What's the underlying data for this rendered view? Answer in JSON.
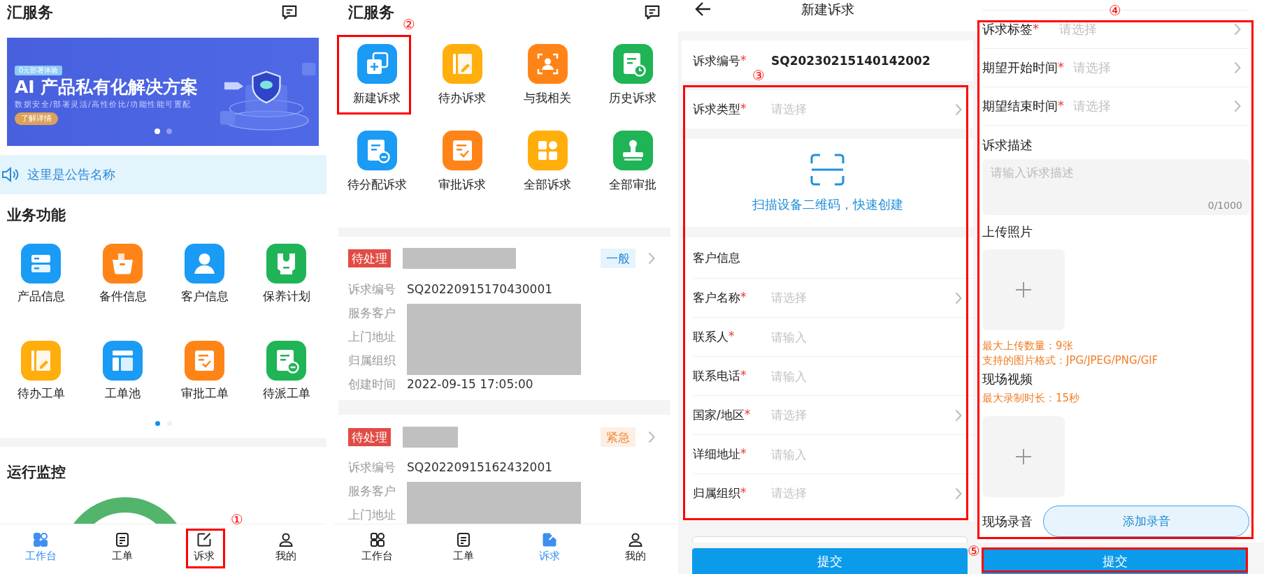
{
  "home": {
    "title": "汇服务",
    "banner": {
      "tag": "0元部署体验",
      "headline": "AI 产品私有化解决方案",
      "subtitle": "数据安全/部署灵活/高性价比/功能性能可置配",
      "button": "了解详情",
      "slides": [
        {
          "selected": true
        },
        {
          "selected": false
        }
      ]
    },
    "notice": "这里是公告名称",
    "functions": {
      "title": "业务功能",
      "items": [
        {
          "label": "产品信息",
          "color": "#1a9bf5"
        },
        {
          "label": "备件信息",
          "color": "#ff8417"
        },
        {
          "label": "客户信息",
          "color": "#1a9bf5"
        },
        {
          "label": "保养计划",
          "color": "#1fb455"
        },
        {
          "label": "待办工单",
          "color": "#ffae0c"
        },
        {
          "label": "工单池",
          "color": "#1a9bf5"
        },
        {
          "label": "审批工单",
          "color": "#ff8417"
        },
        {
          "label": "待派工单",
          "color": "#1fb455"
        }
      ],
      "pages": [
        {
          "selected": true
        },
        {
          "selected": false
        }
      ]
    },
    "monitor": {
      "title": "运行监控"
    },
    "nav": [
      {
        "label": "工作台",
        "selected": true
      },
      {
        "label": "工单",
        "selected": false
      },
      {
        "label": "诉求",
        "selected": false
      },
      {
        "label": "我的",
        "selected": false
      }
    ]
  },
  "requests": {
    "title": "汇服务",
    "items": [
      {
        "label": "新建诉求",
        "color": "#1a9bf5"
      },
      {
        "label": "待办诉求",
        "color": "#ffae0c"
      },
      {
        "label": "与我相关",
        "color": "#ff8417"
      },
      {
        "label": "历史诉求",
        "color": "#1fb455"
      },
      {
        "label": "待分配诉求",
        "color": "#1a9bf5"
      },
      {
        "label": "审批诉求",
        "color": "#ff8417"
      },
      {
        "label": "全部诉求",
        "color": "#ffae0c"
      },
      {
        "label": "全部审批",
        "color": "#1fb455"
      }
    ],
    "cards": [
      {
        "status": "待处理",
        "priority": {
          "text": "一般",
          "kind": "normal"
        },
        "fields": [
          {
            "label": "诉求编号",
            "value": "SQ20220915170430001"
          },
          {
            "label": "服务客户"
          },
          {
            "label": "上门地址"
          },
          {
            "label": "归属组织"
          },
          {
            "label": "创建时间",
            "value": "2022-09-15 17:05:00"
          }
        ]
      },
      {
        "status": "待处理",
        "priority": {
          "text": "紧急",
          "kind": "urgent"
        },
        "fields": [
          {
            "label": "诉求编号",
            "value": "SQ20220915162432001"
          },
          {
            "label": "服务客户"
          },
          {
            "label": "上门地址"
          }
        ]
      }
    ],
    "nav": [
      {
        "label": "工作台",
        "selected": false
      },
      {
        "label": "工单",
        "selected": false
      },
      {
        "label": "诉求",
        "selected": true
      },
      {
        "label": "我的",
        "selected": false
      }
    ]
  },
  "new_request": {
    "title": "新建诉求",
    "number": {
      "label": "诉求编号",
      "asterisk": "*",
      "value": "SQ20230215140142002"
    },
    "type": {
      "label": "诉求类型",
      "asterisk": "*",
      "placeholder": "请选择",
      "kind": "select"
    },
    "scan": "扫描设备二维码，快速创建",
    "customer": {
      "title": "客户信息",
      "fields": [
        {
          "label": "客户名称",
          "asterisk": "*",
          "placeholder": "请选择",
          "kind": "select"
        },
        {
          "label": "联系人",
          "asterisk": "*",
          "placeholder": "请输入",
          "kind": "input"
        },
        {
          "label": "联系电话",
          "asterisk": "*",
          "placeholder": "请输入",
          "kind": "input"
        },
        {
          "label": "国家/地区",
          "asterisk": "*",
          "placeholder": "请选择",
          "kind": "select"
        },
        {
          "label": "详细地址",
          "asterisk": "*",
          "placeholder": "请输入",
          "kind": "input"
        },
        {
          "label": "归属组织",
          "asterisk": "*",
          "placeholder": "请选择",
          "kind": "select"
        }
      ]
    },
    "submit": "提交"
  },
  "details": {
    "fields": [
      {
        "label": "诉求标签",
        "asterisk": "*",
        "placeholder": "请选择",
        "kind": "select"
      },
      {
        "label": "期望开始时间",
        "asterisk": "*",
        "placeholder": "请选择",
        "kind": "select"
      },
      {
        "label": "期望结束时间",
        "asterisk": "*",
        "placeholder": "请选择",
        "kind": "select"
      }
    ],
    "description": {
      "label": "诉求描述",
      "placeholder": "请输入诉求描述",
      "counter": "0/1000"
    },
    "photos": {
      "label": "上传照片",
      "hints": [
        "最大上传数量：9张",
        "支持的图片格式：JPG/JPEG/PNG/GIF"
      ]
    },
    "video": {
      "label": "现场视频",
      "hints": [
        "最大录制时长：15秒"
      ]
    },
    "audio": {
      "label": "现场录音",
      "button": "添加录音"
    },
    "submit": "提交"
  },
  "annotations": [
    {
      "label": "①"
    },
    {
      "label": "②"
    },
    {
      "label": "③"
    },
    {
      "label": "④"
    },
    {
      "label": "⑤"
    }
  ]
}
